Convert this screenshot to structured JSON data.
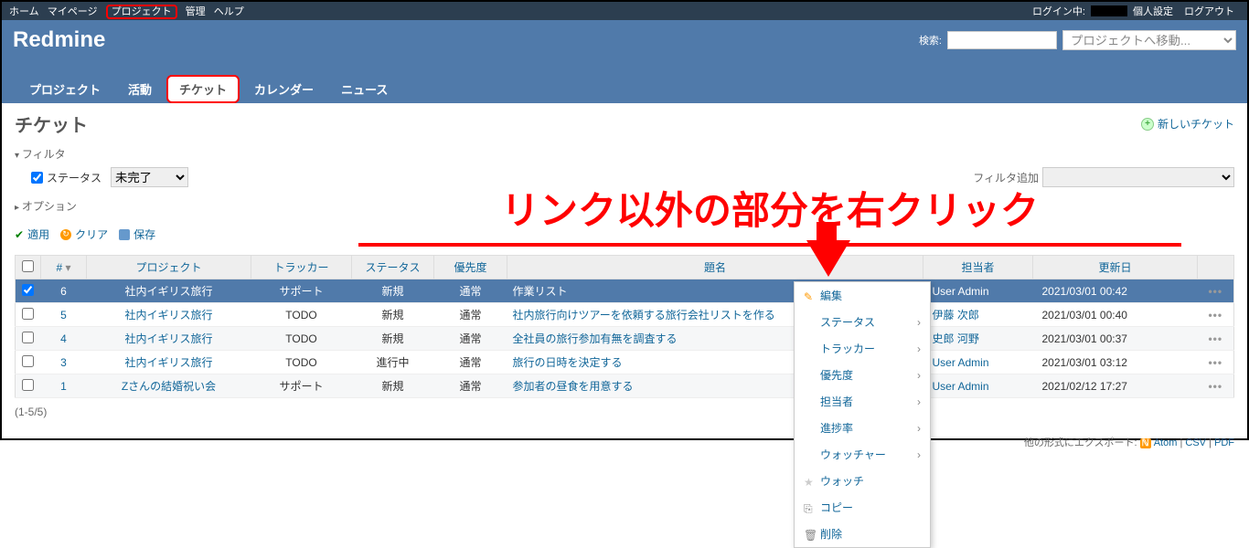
{
  "top_menu": {
    "left": [
      "ホーム",
      "マイページ",
      "プロジェクト",
      "管理",
      "ヘルプ"
    ],
    "login_label": "ログイン中:",
    "settings": "個人設定",
    "logout": "ログアウト"
  },
  "header": {
    "title": "Redmine",
    "search_label": "検索:",
    "project_jump": "プロジェクトへ移動..."
  },
  "main_menu": [
    "プロジェクト",
    "活動",
    "チケット",
    "カレンダー",
    "ニュース"
  ],
  "content": {
    "title": "チケット",
    "new_ticket": "新しいチケット",
    "filter_legend": "フィルタ",
    "status_label": "ステータス",
    "status_value": "未完了",
    "options_legend": "オプション",
    "filter_add_label": "フィルタ追加",
    "apply": "適用",
    "clear": "クリア",
    "save": "保存"
  },
  "annotation": "リンク以外の部分を右クリック",
  "table": {
    "headers": [
      "#",
      "プロジェクト",
      "トラッカー",
      "ステータス",
      "優先度",
      "題名",
      "担当者",
      "更新日"
    ],
    "rows": [
      {
        "id": "6",
        "project": "社内イギリス旅行",
        "tracker": "サポート",
        "status": "新規",
        "priority": "通常",
        "subject": "作業リスト",
        "assignee": "User Admin",
        "updated": "2021/03/01 00:42",
        "selected": true
      },
      {
        "id": "5",
        "project": "社内イギリス旅行",
        "tracker": "TODO",
        "status": "新規",
        "priority": "通常",
        "subject": "社内旅行向けツアーを依頼する旅行会社リストを作る",
        "assignee": "伊藤 次郎",
        "updated": "2021/03/01 00:40"
      },
      {
        "id": "4",
        "project": "社内イギリス旅行",
        "tracker": "TODO",
        "status": "新規",
        "priority": "通常",
        "subject": "全社員の旅行参加有無を調査する",
        "assignee": "史郎 河野",
        "updated": "2021/03/01 00:37"
      },
      {
        "id": "3",
        "project": "社内イギリス旅行",
        "tracker": "TODO",
        "status": "進行中",
        "priority": "通常",
        "subject": "旅行の日時を決定する",
        "assignee": "User Admin",
        "updated": "2021/03/01 03:12"
      },
      {
        "id": "1",
        "project": "Zさんの結婚祝い会",
        "tracker": "サポート",
        "status": "新規",
        "priority": "通常",
        "subject": "参加者の昼食を用意する",
        "assignee": "User Admin",
        "updated": "2021/02/12 17:27"
      }
    ]
  },
  "pagination": "(1-5/5)",
  "export": {
    "label": "他の形式にエクスポート:",
    "atom": "Atom",
    "csv": "CSV",
    "pdf": "PDF"
  },
  "context_menu": [
    {
      "label": "編集",
      "icon": "pencil"
    },
    {
      "label": "ステータス",
      "sub": true
    },
    {
      "label": "トラッカー",
      "sub": true
    },
    {
      "label": "優先度",
      "sub": true
    },
    {
      "label": "担当者",
      "sub": true
    },
    {
      "label": "進捗率",
      "sub": true
    },
    {
      "label": "ウォッチャー",
      "sub": true
    },
    {
      "label": "ウォッチ",
      "icon": "star"
    },
    {
      "label": "コピー",
      "icon": "copy"
    },
    {
      "label": "削除",
      "icon": "trash"
    }
  ]
}
